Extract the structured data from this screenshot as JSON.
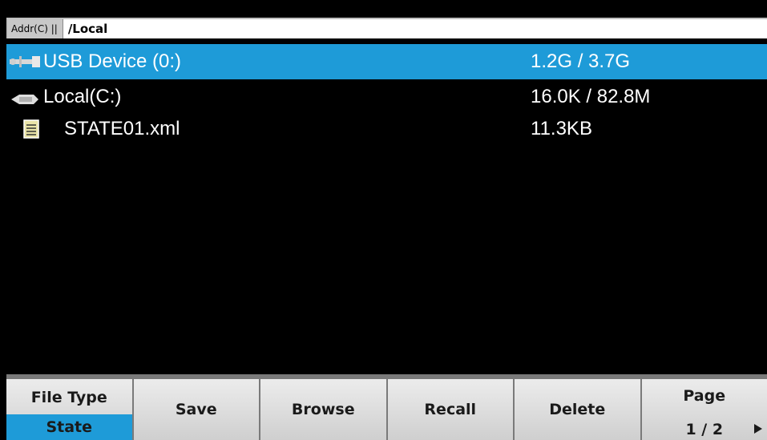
{
  "address": {
    "label": "Addr(C) ||",
    "path": "/Local"
  },
  "files": [
    {
      "name": "USB Device (0:)",
      "size": "1.2G / 3.7G",
      "icon": "usb-icon"
    },
    {
      "name": "Local(C:)",
      "size": "16.0K / 82.8M",
      "icon": "drive-icon"
    },
    {
      "name": "STATE01.xml",
      "size": "11.3KB",
      "icon": "document-icon"
    }
  ],
  "softkeys": {
    "file_type": {
      "label": "File Type",
      "value": "State"
    },
    "save": "Save",
    "browse": "Browse",
    "recall": "Recall",
    "delete": "Delete",
    "page": {
      "label": "Page",
      "value": "1 / 2"
    }
  },
  "colors": {
    "selection": "#1e9bd8",
    "softkey_bg": "#dcdcdc"
  }
}
